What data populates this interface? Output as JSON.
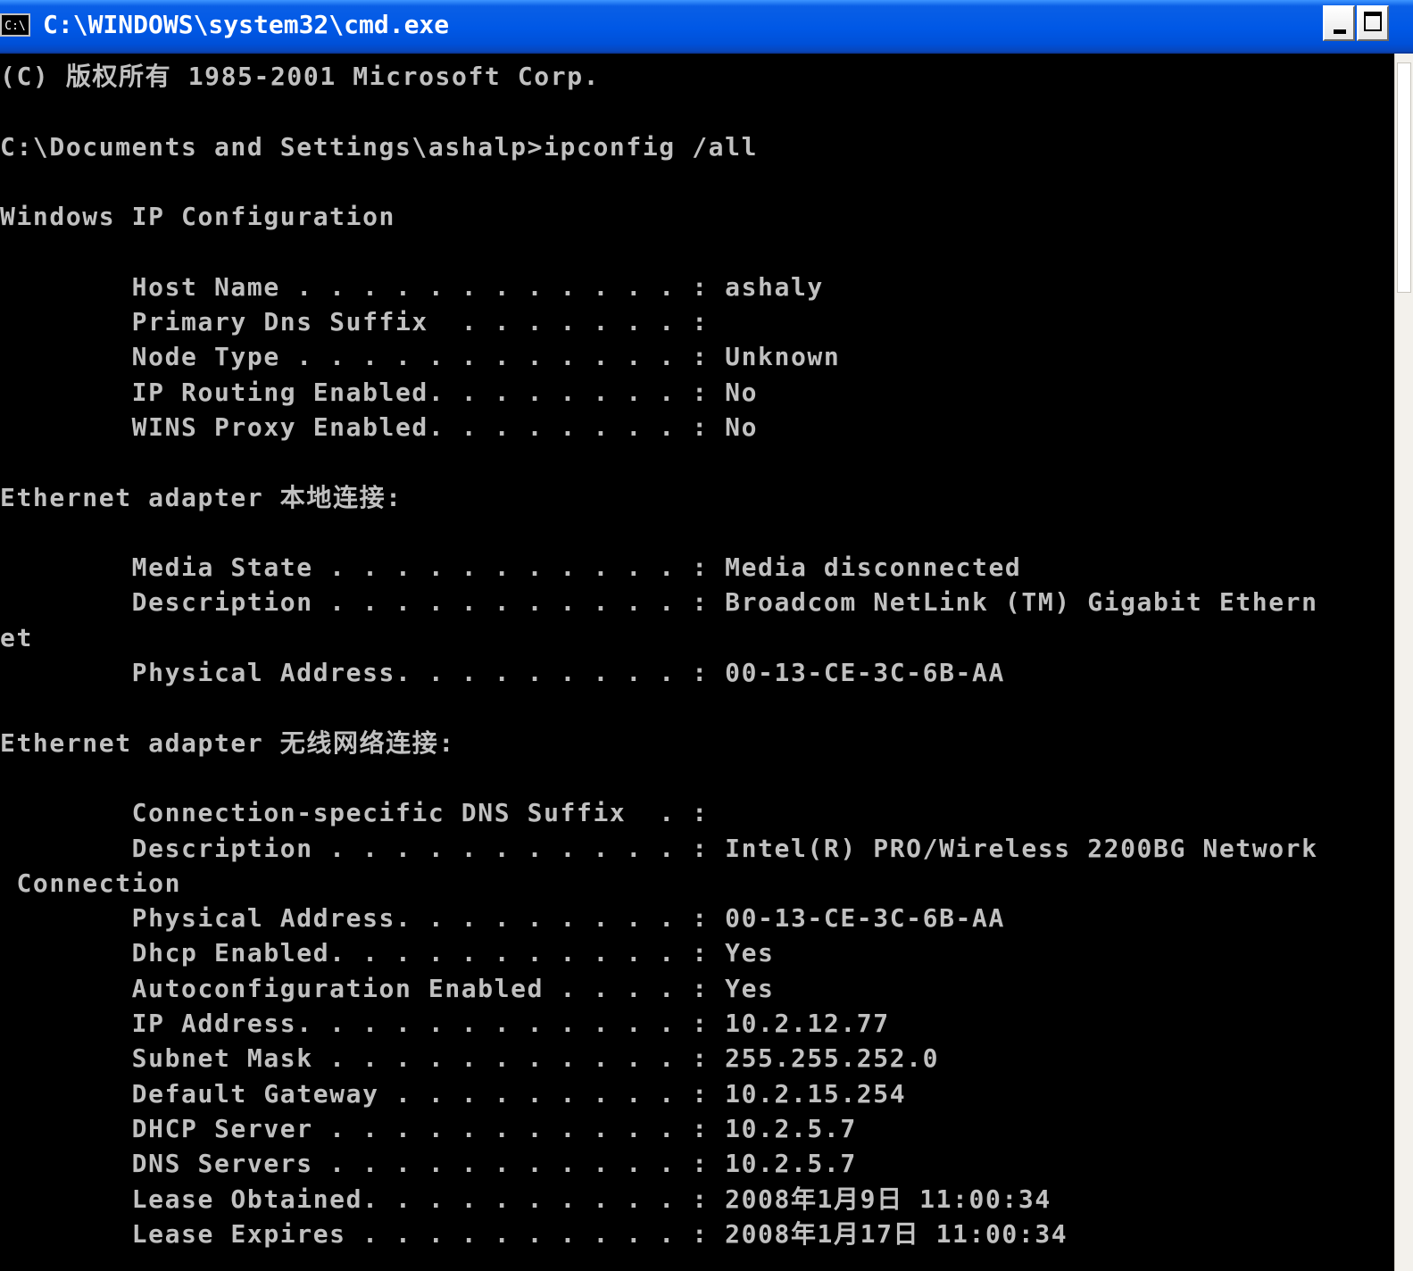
{
  "window": {
    "title": "C:\\WINDOWS\\system32\\cmd.exe",
    "icon_label": "C:\\"
  },
  "console": {
    "lines": [
      "(C) 版权所有 1985-2001 Microsoft Corp.",
      "",
      "C:\\Documents and Settings\\ashalp>ipconfig /all",
      "",
      "Windows IP Configuration",
      "",
      "        Host Name . . . . . . . . . . . . : ashaly",
      "        Primary Dns Suffix  . . . . . . . :",
      "        Node Type . . . . . . . . . . . . : Unknown",
      "        IP Routing Enabled. . . . . . . . : No",
      "        WINS Proxy Enabled. . . . . . . . : No",
      "",
      "Ethernet adapter 本地连接:",
      "",
      "        Media State . . . . . . . . . . . : Media disconnected",
      "        Description . . . . . . . . . . . : Broadcom NetLink (TM) Gigabit Ethern",
      "et",
      "        Physical Address. . . . . . . . . : 00-13-CE-3C-6B-AA",
      "",
      "Ethernet adapter 无线网络连接:",
      "",
      "        Connection-specific DNS Suffix  . :",
      "        Description . . . . . . . . . . . : Intel(R) PRO/Wireless 2200BG Network",
      " Connection",
      "        Physical Address. . . . . . . . . : 00-13-CE-3C-6B-AA",
      "        Dhcp Enabled. . . . . . . . . . . : Yes",
      "        Autoconfiguration Enabled . . . . : Yes",
      "        IP Address. . . . . . . . . . . . : 10.2.12.77",
      "        Subnet Mask . . . . . . . . . . . : 255.255.252.0",
      "        Default Gateway . . . . . . . . . : 10.2.15.254",
      "        DHCP Server . . . . . . . . . . . : 10.2.5.7",
      "        DNS Servers . . . . . . . . . . . : 10.2.5.7",
      "        Lease Obtained. . . . . . . . . . : 2008年1月9日 11:00:34",
      "        Lease Expires . . . . . . . . . . : 2008年1月17日 11:00:34"
    ]
  },
  "colors": {
    "console_background": "#000000",
    "console_text": "#c0c0c0",
    "titlebar_blue": "#0058e6"
  },
  "icons": {
    "app": "cmd-icon",
    "minimize": "minimize-icon",
    "maximize": "maximize-icon"
  }
}
